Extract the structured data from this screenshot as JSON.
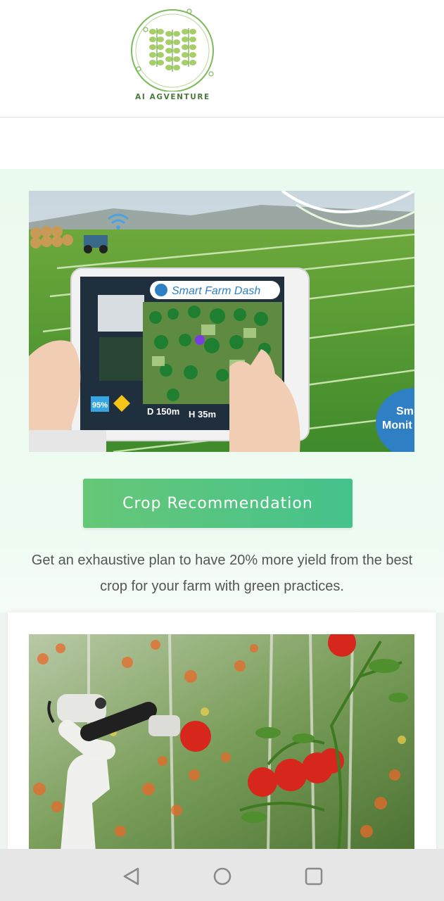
{
  "brand": {
    "logo_text": "AI AGVENTURE"
  },
  "card1": {
    "hero_alt": "smart-farm-tablet",
    "tablet_title": "Smart Farm Dash",
    "tablet_stat_d": "D 150m",
    "tablet_stat_h": "H 35m",
    "tablet_badge": "95%",
    "side_label": "Smart Monitoring",
    "button_label": "Crop Recommendation",
    "description": "Get an exhaustive plan to have 20% more yield from the best crop for your farm with green practices."
  },
  "card2": {
    "hero_alt": "robot-arm-tomatoes"
  },
  "colors": {
    "accent_start": "#66c777",
    "accent_end": "#45c28c",
    "card_bg": "#ebfaee"
  },
  "navbar": {
    "back": "back-icon",
    "home": "home-icon",
    "recents": "recents-icon"
  }
}
